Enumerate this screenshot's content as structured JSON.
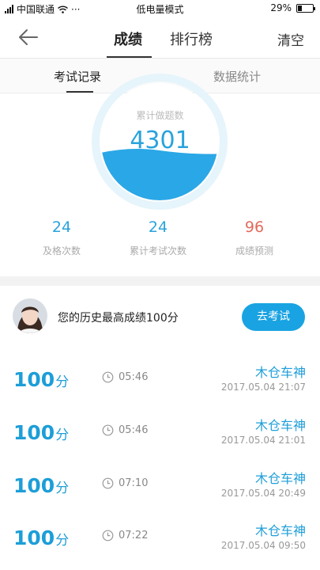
{
  "status_bar": {
    "carrier": "中国联通",
    "more": "···",
    "mode": "低电量模式",
    "battery": "29%"
  },
  "nav": {
    "tab_score": "成绩",
    "tab_rank": "排行榜",
    "clear": "清空"
  },
  "subtabs": {
    "record": "考试记录",
    "stats": "数据统计"
  },
  "gauge": {
    "label": "累计做题数",
    "value": "4301"
  },
  "stats": [
    {
      "value": "24",
      "label": "及格次数"
    },
    {
      "value": "24",
      "label": "累计考试次数"
    },
    {
      "value": "96",
      "label": "成绩预测"
    }
  ],
  "history": {
    "text": "您的历史最高成绩100分",
    "button": "去考试"
  },
  "records": [
    {
      "score": "100",
      "unit": "分",
      "duration": "05:46",
      "name": "木仓车神",
      "date": "2017.05.04  21:07"
    },
    {
      "score": "100",
      "unit": "分",
      "duration": "05:46",
      "name": "木仓车神",
      "date": "2017.05.04  21:01"
    },
    {
      "score": "100",
      "unit": "分",
      "duration": "07:10",
      "name": "木仓车神",
      "date": "2017.05.04  20:49"
    },
    {
      "score": "100",
      "unit": "分",
      "duration": "07:22",
      "name": "木仓车神",
      "date": "2017.05.04  09:50"
    }
  ],
  "colors": {
    "accent": "#1d9ed8",
    "prediction": "#e36a5a",
    "button": "#1aa3e2"
  },
  "icons": {
    "back": "arrow-left-icon",
    "clock": "clock-icon"
  }
}
